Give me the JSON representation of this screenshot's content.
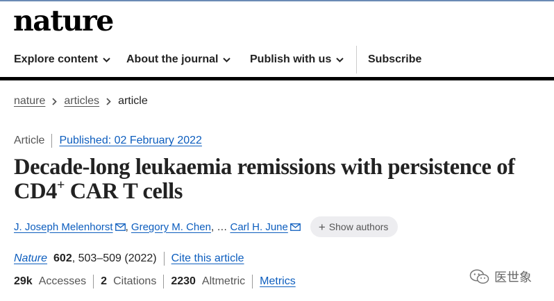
{
  "site": {
    "logo_text": "nature"
  },
  "nav": {
    "items": [
      {
        "label": "Explore content"
      },
      {
        "label": "About the journal"
      },
      {
        "label": "Publish with us"
      }
    ],
    "subscribe_label": "Subscribe"
  },
  "breadcrumb": {
    "items": [
      "nature",
      "articles",
      "article"
    ]
  },
  "article": {
    "type": "Article",
    "published": "Published: 02 February 2022",
    "title_main": "Decade-long leukaemia remissions with persistence of CD4",
    "title_sup": "+",
    "title_tail": " CAR T cells",
    "authors": [
      "J. Joseph Melenhorst",
      "Gregory M. Chen",
      "Carl H. June"
    ],
    "authors_ellipsis": "…",
    "show_authors_label": "Show authors"
  },
  "citation": {
    "journal": "Nature",
    "volume": "602",
    "pages_year": ", 503–509 (2022)",
    "cite_label": "Cite this article"
  },
  "metrics": {
    "accesses_value": "29k",
    "accesses_label": "Accesses",
    "citations_value": "2",
    "citations_label": "Citations",
    "altmetric_value": "2230",
    "altmetric_label": "Altmetric",
    "metrics_label": "Metrics"
  },
  "watermark": {
    "text": "医世象"
  },
  "colors": {
    "link": "#0c5dbe",
    "topline": "#6b8ab5",
    "nav_bar": "#000000"
  }
}
